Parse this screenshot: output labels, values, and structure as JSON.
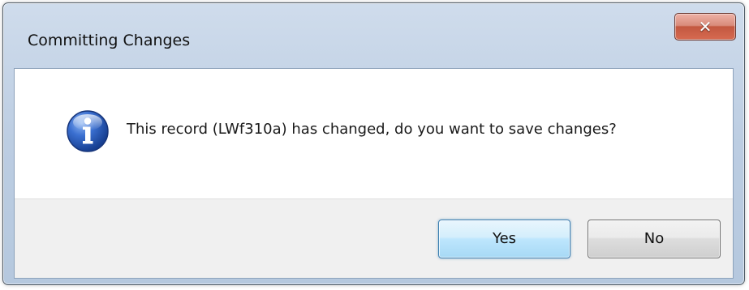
{
  "window": {
    "title": "Committing Changes",
    "close_icon": "close-icon"
  },
  "message": {
    "icon": "info-icon",
    "text": "This record (LWf310a) has changed, do you want to save changes?"
  },
  "buttons": {
    "yes_label": "Yes",
    "no_label": "No"
  },
  "colors": {
    "titlebar": "#bccde2",
    "close_button": "#c35840",
    "default_button": "#bee6fd",
    "button_area": "#f0f0f0",
    "info_icon": "#2456b8"
  }
}
